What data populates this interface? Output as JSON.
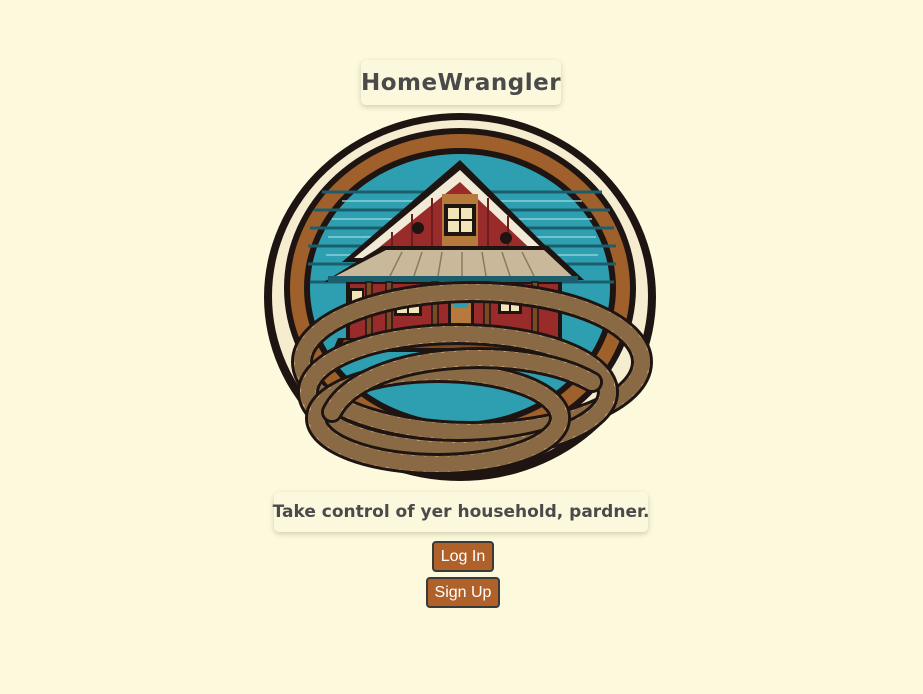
{
  "app": {
    "title": "HomeWrangler",
    "tagline": "Take control of yer household, pardner."
  },
  "logo": {
    "icon": "ranch-house-with-lasso-logo",
    "colors": {
      "outline": "#1e1512",
      "ring": "#a0602c",
      "sky": "#2e9fb0",
      "barn_red": "#9a2b2b",
      "roof": "#c9b89a",
      "wood": "#7a4a24",
      "window": "#f2e6b8",
      "rope": "#c8a376"
    }
  },
  "buttons": {
    "login_label": "Log In",
    "signup_label": "Sign Up",
    "color": "#b0612a"
  }
}
